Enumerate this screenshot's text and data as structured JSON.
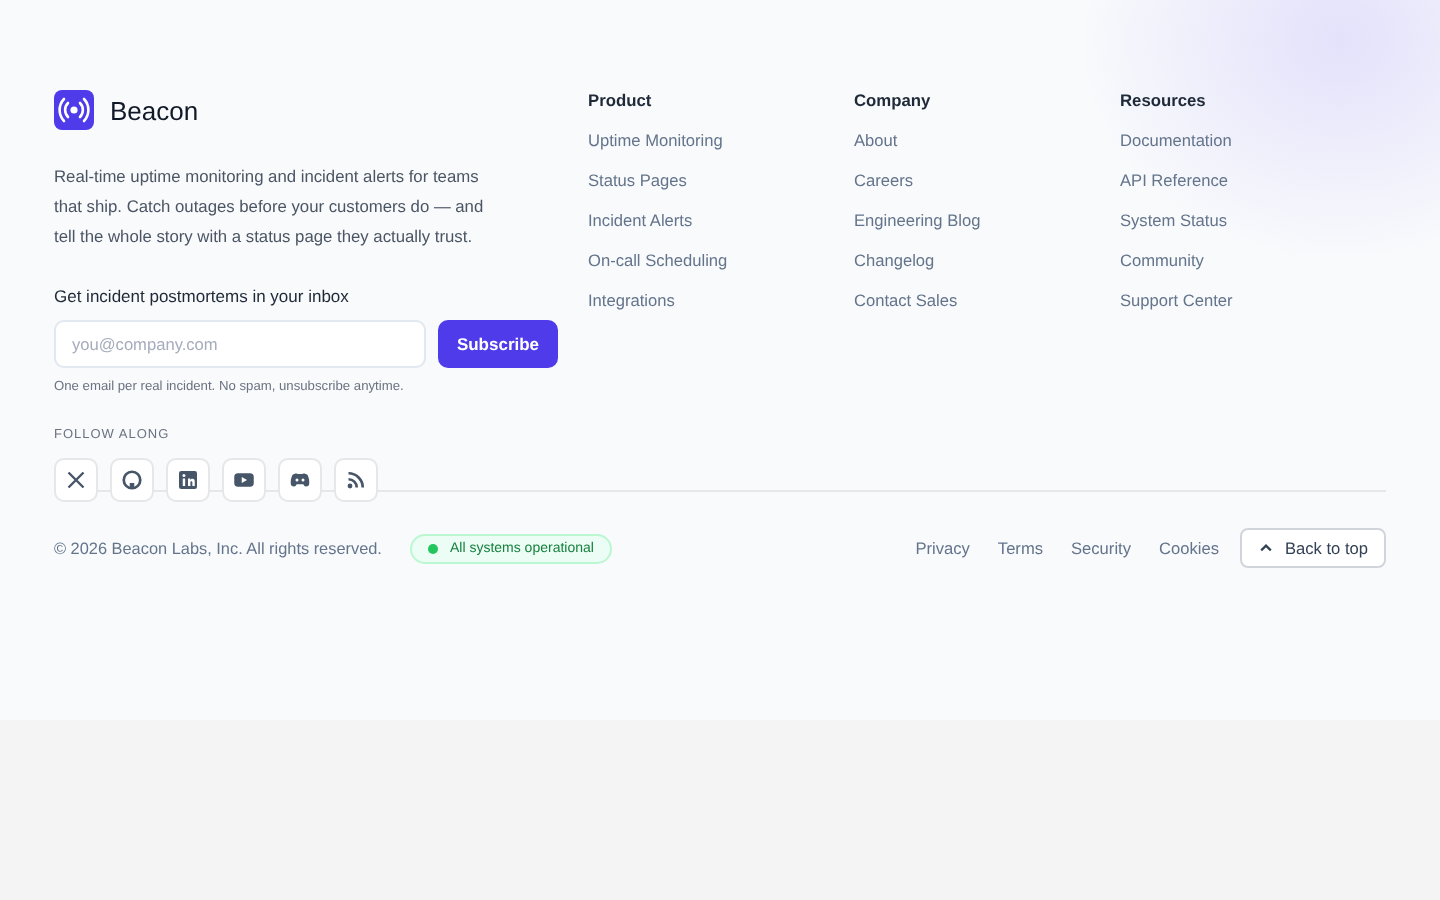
{
  "brand": {
    "name": "Beacon",
    "tagline": "Real-time uptime monitoring and incident alerts for teams that ship. Catch outages before your customers do — and tell the whole story with a status page they actually trust."
  },
  "newsletter": {
    "heading": "Get incident postmortems in your inbox",
    "placeholder": "you@company.com",
    "button": "Subscribe",
    "note": "One email per real incident. No spam, unsubscribe anytime."
  },
  "social": {
    "heading": "FOLLOW ALONG"
  },
  "columns": [
    {
      "title": "Product",
      "links": [
        "Uptime Monitoring",
        "Status Pages",
        "Incident Alerts",
        "On-call Scheduling",
        "Integrations"
      ]
    },
    {
      "title": "Company",
      "links": [
        "About",
        "Careers",
        "Engineering Blog",
        "Changelog",
        "Contact Sales"
      ]
    },
    {
      "title": "Resources",
      "links": [
        "Documentation",
        "API Reference",
        "System Status",
        "Community",
        "Support Center"
      ]
    }
  ],
  "bottom": {
    "copyright": "© 2026 Beacon Labs, Inc. All rights reserved.",
    "status": {
      "label": "All systems operational",
      "color": "#22c55e"
    },
    "links": [
      "Privacy",
      "Terms",
      "Security",
      "Cookies"
    ],
    "back_to_top": "Back to top"
  }
}
